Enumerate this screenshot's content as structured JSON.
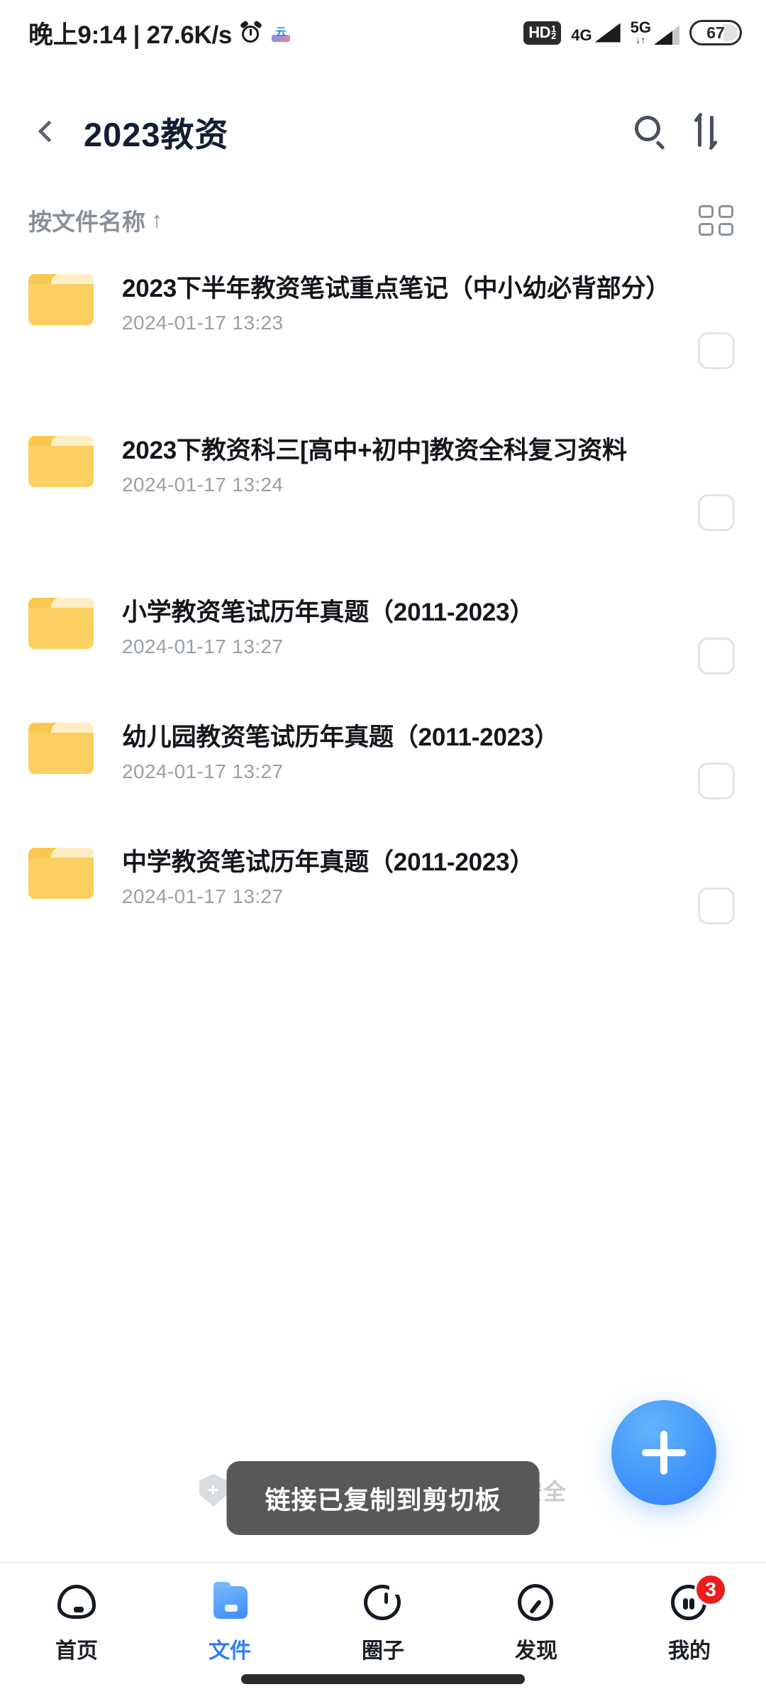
{
  "status_bar": {
    "clock": "晚上9:14 | 27.6K/s",
    "alarm_icon": "alarm-clock-icon",
    "app_icon": "cloud-app-icon",
    "app_icon_text": "云",
    "hd_label": "HD",
    "hd_sim_top": "1",
    "hd_sim_bottom": "2",
    "sim1_network": "4G",
    "sim2_network": "5G",
    "data_arrows": "↓↑",
    "battery_percent": "67"
  },
  "header": {
    "back_icon": "back-chevron-icon",
    "title": "2023教资",
    "search_icon": "search-icon",
    "sort_icon": "sort-icon"
  },
  "sort_bar": {
    "label": "按文件名称",
    "direction_arrow": "↑",
    "grid_toggle_icon": "grid-view-icon"
  },
  "files": [
    {
      "name": "2023下半年教资笔试重点笔记（中小幼必背部分）",
      "date": "2024-01-17 13:23",
      "icon": "folder-icon",
      "selected": false
    },
    {
      "name": "2023下教资科三[高中+初中]教资全科复习资料",
      "date": "2024-01-17 13:24",
      "icon": "folder-icon",
      "selected": false
    },
    {
      "name": "小学教资笔试历年真题（2011-2023）",
      "date": "2024-01-17 13:27",
      "icon": "folder-icon",
      "selected": false
    },
    {
      "name": "幼儿园教资笔试历年真题（2011-2023）",
      "date": "2024-01-17 13:27",
      "icon": "folder-icon",
      "selected": false
    },
    {
      "name": "中学教资笔试历年真题（2011-2023）",
      "date": "2024-01-17 13:27",
      "icon": "folder-icon",
      "selected": false
    }
  ],
  "promo": {
    "text": "中国移动云盘保障您的数据安全",
    "icon": "shield-plus-icon"
  },
  "toast": {
    "message": "链接已复制到剪切板"
  },
  "fab": {
    "icon": "plus-icon",
    "color": "#2f7efb"
  },
  "bottom_nav": {
    "active_color": "#2f7efb",
    "items": [
      {
        "label": "首页",
        "icon": "cloud-icon",
        "active": false,
        "badge": ""
      },
      {
        "label": "文件",
        "icon": "folder-icon",
        "active": true,
        "badge": ""
      },
      {
        "label": "圈子",
        "icon": "circle-icon",
        "active": false,
        "badge": ""
      },
      {
        "label": "发现",
        "icon": "compass-icon",
        "active": false,
        "badge": ""
      },
      {
        "label": "我的",
        "icon": "face-icon",
        "active": false,
        "badge": "3"
      }
    ]
  }
}
